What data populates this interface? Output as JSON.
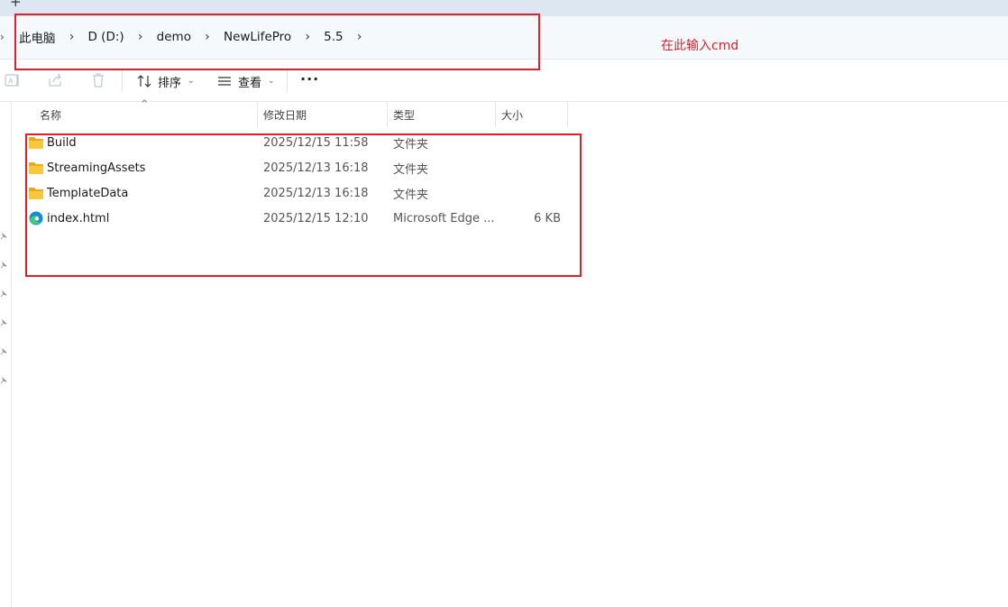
{
  "tabstrip": {
    "new_tab_label": "+"
  },
  "address": {
    "crumbs": [
      {
        "label": "此电脑"
      },
      {
        "label": "D (D:)"
      },
      {
        "label": "demo"
      },
      {
        "label": "NewLifePro"
      },
      {
        "label": "5.5"
      }
    ]
  },
  "annotation": {
    "text": "在此输入cmd",
    "color": "#e0202a"
  },
  "toolbar": {
    "sort_label": "排序",
    "view_label": "查看",
    "more_label": "···"
  },
  "columns": {
    "name": "名称",
    "date": "修改日期",
    "type": "类型",
    "size": "大小"
  },
  "files": [
    {
      "name": "Build",
      "date": "2025/12/15 11:58",
      "type": "文件夹",
      "size": "",
      "icon": "folder-icon"
    },
    {
      "name": "StreamingAssets",
      "date": "2025/12/13 16:18",
      "type": "文件夹",
      "size": "",
      "icon": "folder-icon"
    },
    {
      "name": "TemplateData",
      "date": "2025/12/13 16:18",
      "type": "文件夹",
      "size": "",
      "icon": "folder-icon"
    },
    {
      "name": "index.html",
      "date": "2025/12/15 12:10",
      "type": "Microsoft Edge ...",
      "size": "6 KB",
      "icon": "edge-icon"
    }
  ],
  "colors": {
    "folder": "#f8c73c",
    "accent": "#0067c0",
    "annotation": "#e0202a"
  }
}
